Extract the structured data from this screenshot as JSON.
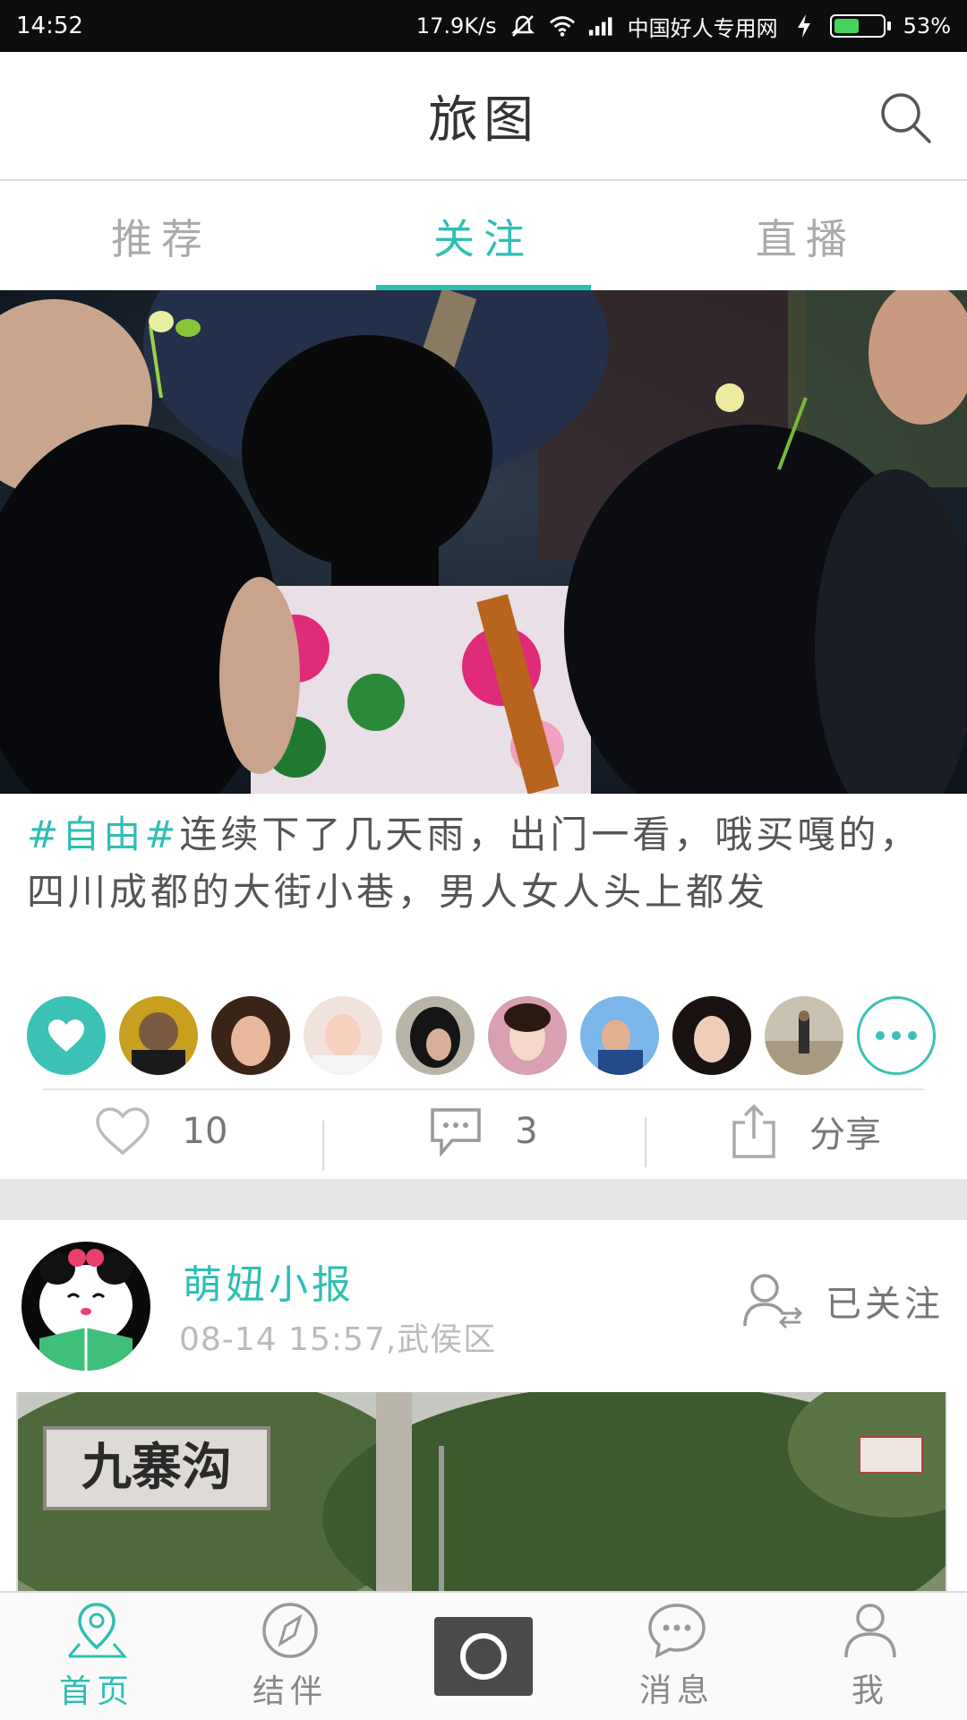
{
  "status_bar": {
    "time": "14:52",
    "network_speed": "17.9K/s",
    "carrier": "中国好人专用网",
    "battery": "53%",
    "battery_level": 0.53
  },
  "header": {
    "title": "旅图"
  },
  "tabs": [
    {
      "label": "推荐",
      "active": false
    },
    {
      "label": "关注",
      "active": true
    },
    {
      "label": "直播",
      "active": false
    }
  ],
  "post1": {
    "tag": "#自由#",
    "text": "连续下了几天雨，出门一看，哦买嘎的，",
    "text2": "四川成都的大街小巷，男人女人头上都发",
    "likes": "10",
    "comments": "3",
    "share_label": "分享"
  },
  "post2": {
    "author": "萌妞小报",
    "meta": "08-14 15:57,武侯区",
    "follow_label": "已关注",
    "sign_text": "九寨沟"
  },
  "bottom_nav": [
    {
      "label": "首页",
      "active": true
    },
    {
      "label": "结伴",
      "active": false
    },
    {
      "label": "",
      "active": false
    },
    {
      "label": "消息",
      "active": false
    },
    {
      "label": "我",
      "active": false
    }
  ],
  "colors": {
    "accent": "#2ebfb3",
    "status_bar": "#0d0d0d",
    "battery": "#45d35c"
  }
}
